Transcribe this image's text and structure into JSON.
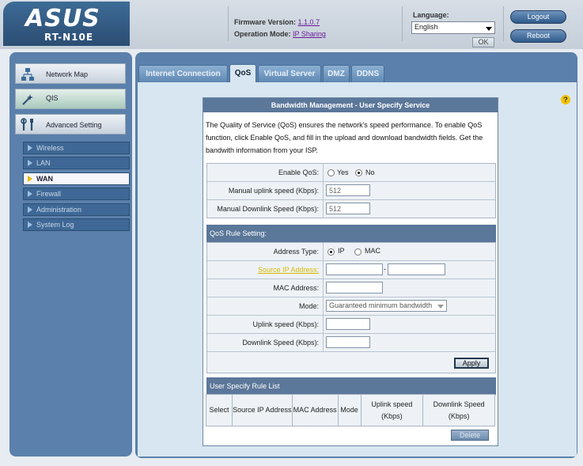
{
  "header": {
    "logo": "ASUS",
    "model": "RT-N10E",
    "firmware_label": "Firmware Version:",
    "firmware_value": "1.1.0.7",
    "opmode_label": "Operation Mode:",
    "opmode_value": "IP Sharing",
    "language_label": "Language:",
    "language_value": "English",
    "ok_label": "OK",
    "logout_label": "Logout",
    "reboot_label": "Reboot"
  },
  "sidebar": {
    "main_items": [
      {
        "label": "Network Map",
        "icon": "network-map-icon"
      },
      {
        "label": "QIS",
        "icon": "wand-icon"
      },
      {
        "label": "Advanced Setting",
        "icon": "tools-icon"
      }
    ],
    "sub_items": [
      {
        "label": "Wireless"
      },
      {
        "label": "LAN"
      },
      {
        "label": "WAN",
        "active": true
      },
      {
        "label": "Firewall"
      },
      {
        "label": "Administration"
      },
      {
        "label": "System Log"
      }
    ]
  },
  "tabs": [
    "Internet Connection",
    "QoS",
    "Virtual Server",
    "DMZ",
    "DDNS"
  ],
  "active_tab": "QoS",
  "panel": {
    "title": "Bandwidth Management - User Specify Service",
    "description": "The Quality of Service (QoS) ensures the network's speed performance. To enable QoS function, click Enable QoS, and fill in the upload and download bandwidth fields. Get the bandwith information from your ISP.",
    "enable_qos_label": "Enable QoS:",
    "yes_label": "Yes",
    "no_label": "No",
    "enable_qos_value": "No",
    "uplink_label": "Manual uplink speed (Kbps):",
    "uplink_value": "512",
    "downlink_label": "Manual Downlink Speed (Kbps):",
    "downlink_value": "512"
  },
  "rule_setting": {
    "heading": "QoS Rule Setting:",
    "address_type_label": "Address Type:",
    "ip_label": "IP",
    "mac_label": "MAC",
    "address_type_value": "IP",
    "source_ip_label": "Source IP Address:",
    "ip_range_separator": "-",
    "mac_address_label": "MAC Address:",
    "mode_label": "Mode:",
    "mode_value": "Guaranteed minimum bandwidth",
    "uplink_label": "Uplink speed (Kbps):",
    "downlink_label": "Downlink Speed (Kbps):",
    "apply_label": "Apply"
  },
  "rule_list": {
    "heading": "User Specify Rule List",
    "columns": [
      "Select",
      "Source IP Address",
      "MAC Address",
      "Mode",
      "Uplink speed (Kbps)",
      "Downlink Speed (Kbps)"
    ],
    "delete_label": "Delete"
  },
  "help_icon": "?",
  "colors": {
    "frame": "#5a80ab",
    "panel_header": "#5b7799",
    "content_bg": "#d7e6f0",
    "active_tri": "#e8b800"
  }
}
